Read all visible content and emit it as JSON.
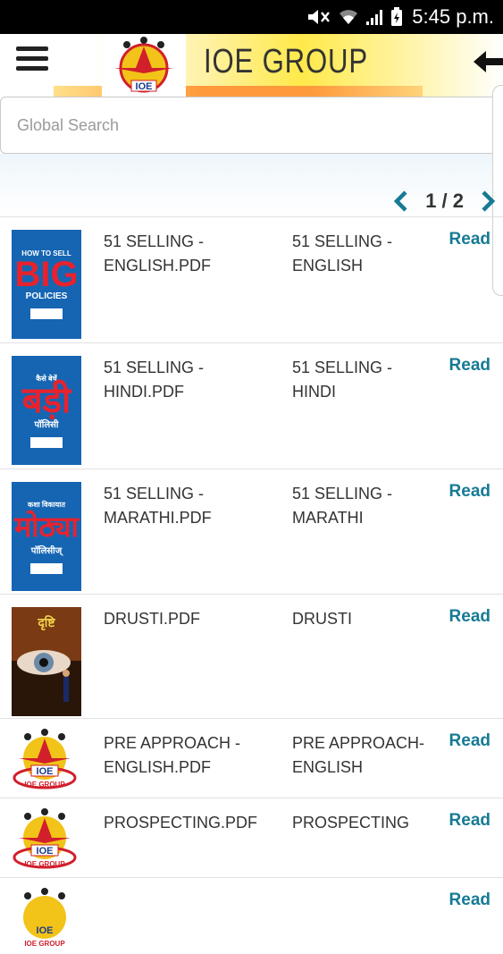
{
  "status_bar": {
    "time": "5:45 p.m."
  },
  "header": {
    "brand": "IOE GROUP",
    "logo_text": "IOE"
  },
  "search": {
    "placeholder": "Global Search"
  },
  "pager": {
    "label": "1 / 2"
  },
  "rows": [
    {
      "file": "51 SELLING - ENGLISH.PDF",
      "title": "51 SELLING - ENGLISH",
      "action": "Read",
      "cover": {
        "kind": "book",
        "top": "HOW TO SELL",
        "big": "BIG",
        "bottom": "POLICIES"
      }
    },
    {
      "file": "51 SELLING - HINDI.PDF",
      "title": "51 SELLING - HINDI",
      "action": "Read",
      "cover": {
        "kind": "book",
        "top": "कैसे बेचें",
        "big": "बड़ी",
        "bottom": "पॉलिसी"
      }
    },
    {
      "file": "51 SELLING - MARATHI.PDF",
      "title": "51 SELLING - MARATHI",
      "action": "Read",
      "cover": {
        "kind": "book",
        "top": "कशा विकायात",
        "big": "मोठ्या",
        "bottom": "पॉलिसीज्"
      }
    },
    {
      "file": "DRUSTI.PDF",
      "title": "DRUSTI",
      "action": "Read",
      "cover": {
        "kind": "eye",
        "top": "दृष्टि"
      }
    },
    {
      "file": "PRE APPROACH - ENGLISH.PDF",
      "title": "PRE APPROACH- ENGLISH",
      "action": "Read",
      "cover": {
        "kind": "logo",
        "label": "IOE",
        "sub": "IOE GROUP"
      }
    },
    {
      "file": "PROSPECTING.PDF",
      "title": "PROSPECTING",
      "action": "Read",
      "cover": {
        "kind": "logo",
        "label": "IOE",
        "sub": "IOE GROUP"
      }
    },
    {
      "file": "",
      "title": "",
      "action": "Read",
      "cover": {
        "kind": "logo",
        "label": "IOE",
        "sub": "IOE GROUP"
      }
    }
  ]
}
